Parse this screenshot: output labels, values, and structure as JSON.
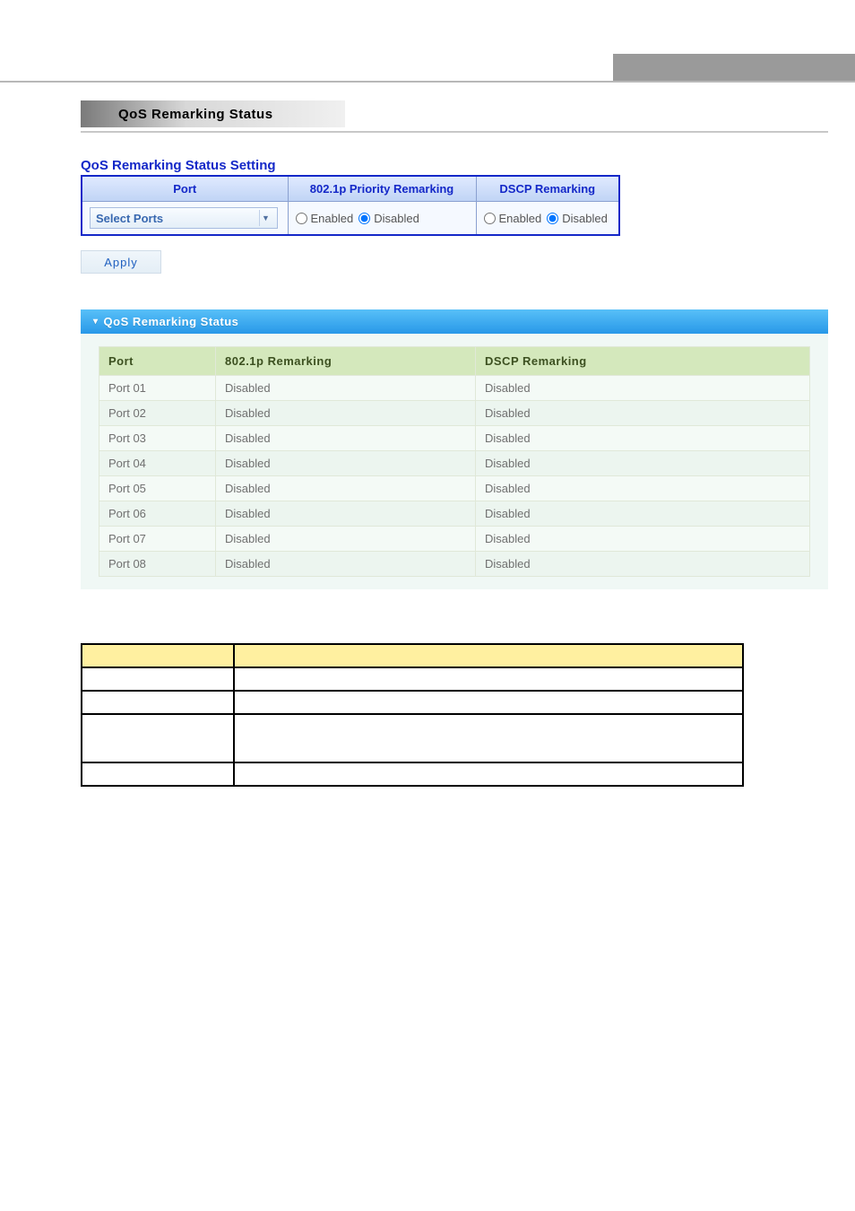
{
  "pageTitle": "QoS Remarking Status",
  "sectionTitle": "QoS Remarking Status Setting",
  "settingsHeaders": {
    "port": "Port",
    "remark8021p": "802.1p Priority Remarking",
    "dscp": "DSCP Remarking"
  },
  "portSelectPlaceholder": "Select Ports",
  "radioLabels": {
    "enabled": "Enabled",
    "disabled": "Disabled"
  },
  "applyLabel": "Apply",
  "statusPanelTitle": "QoS Remarking Status",
  "statusHeaders": {
    "port": "Port",
    "remark8021p": "802.1p Remarking",
    "dscp": "DSCP Remarking"
  },
  "statusRows": [
    {
      "port": "Port 01",
      "r8021p": "Disabled",
      "dscp": "Disabled"
    },
    {
      "port": "Port 02",
      "r8021p": "Disabled",
      "dscp": "Disabled"
    },
    {
      "port": "Port 03",
      "r8021p": "Disabled",
      "dscp": "Disabled"
    },
    {
      "port": "Port 04",
      "r8021p": "Disabled",
      "dscp": "Disabled"
    },
    {
      "port": "Port 05",
      "r8021p": "Disabled",
      "dscp": "Disabled"
    },
    {
      "port": "Port 06",
      "r8021p": "Disabled",
      "dscp": "Disabled"
    },
    {
      "port": "Port 07",
      "r8021p": "Disabled",
      "dscp": "Disabled"
    },
    {
      "port": "Port 08",
      "r8021p": "Disabled",
      "dscp": "Disabled"
    }
  ],
  "legend": {
    "headers": {
      "label": "",
      "desc": ""
    },
    "rows": [
      {
        "label": "",
        "desc": ""
      },
      {
        "label": "",
        "desc": ""
      },
      {
        "label": "",
        "desc": ""
      },
      {
        "label": "",
        "desc": ""
      }
    ]
  }
}
